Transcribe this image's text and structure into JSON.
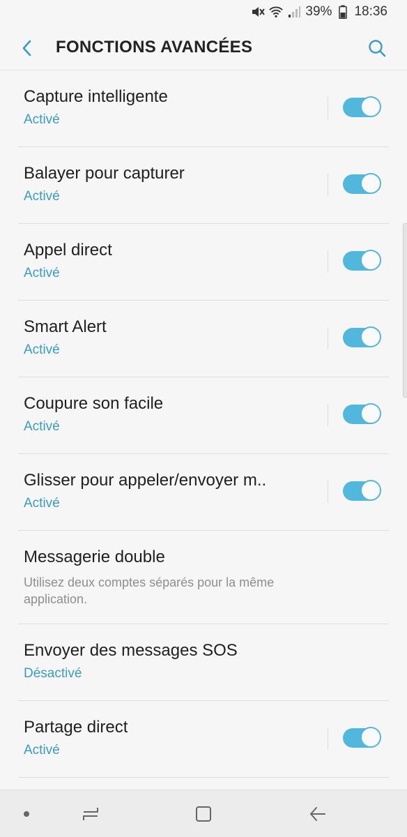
{
  "status_bar": {
    "battery": "39%",
    "time": "18:36",
    "icons": [
      "mute-icon",
      "wifi-icon",
      "signal-icon",
      "battery-icon"
    ]
  },
  "header": {
    "title": "FONCTIONS AVANCÉES",
    "back_icon": "chevron-left-icon",
    "search_icon": "search-icon"
  },
  "colors": {
    "accent": "#3a9cc2",
    "toggle_on": "#52b7dc",
    "background": "#f6f6f6"
  },
  "items": [
    {
      "title": "Capture intelligente",
      "status": "Activé",
      "toggle": true
    },
    {
      "title": "Balayer pour capturer",
      "status": "Activé",
      "toggle": true
    },
    {
      "title": "Appel direct",
      "status": "Activé",
      "toggle": true
    },
    {
      "title": "Smart Alert",
      "status": "Activé",
      "toggle": true
    },
    {
      "title": "Coupure son facile",
      "status": "Activé",
      "toggle": true
    },
    {
      "title": "Glisser pour appeler/envoyer m..",
      "status": "Activé",
      "toggle": true
    },
    {
      "title": "Messagerie double",
      "description": "Utilisez deux comptes séparés pour la même application."
    },
    {
      "title": "Envoyer des messages SOS",
      "status": "Désactivé"
    },
    {
      "title": "Partage direct",
      "status": "Activé",
      "toggle": true
    }
  ],
  "nav_bar": {
    "icons": [
      "dot-icon",
      "recents-icon",
      "home-icon",
      "back-arrow-icon"
    ]
  }
}
